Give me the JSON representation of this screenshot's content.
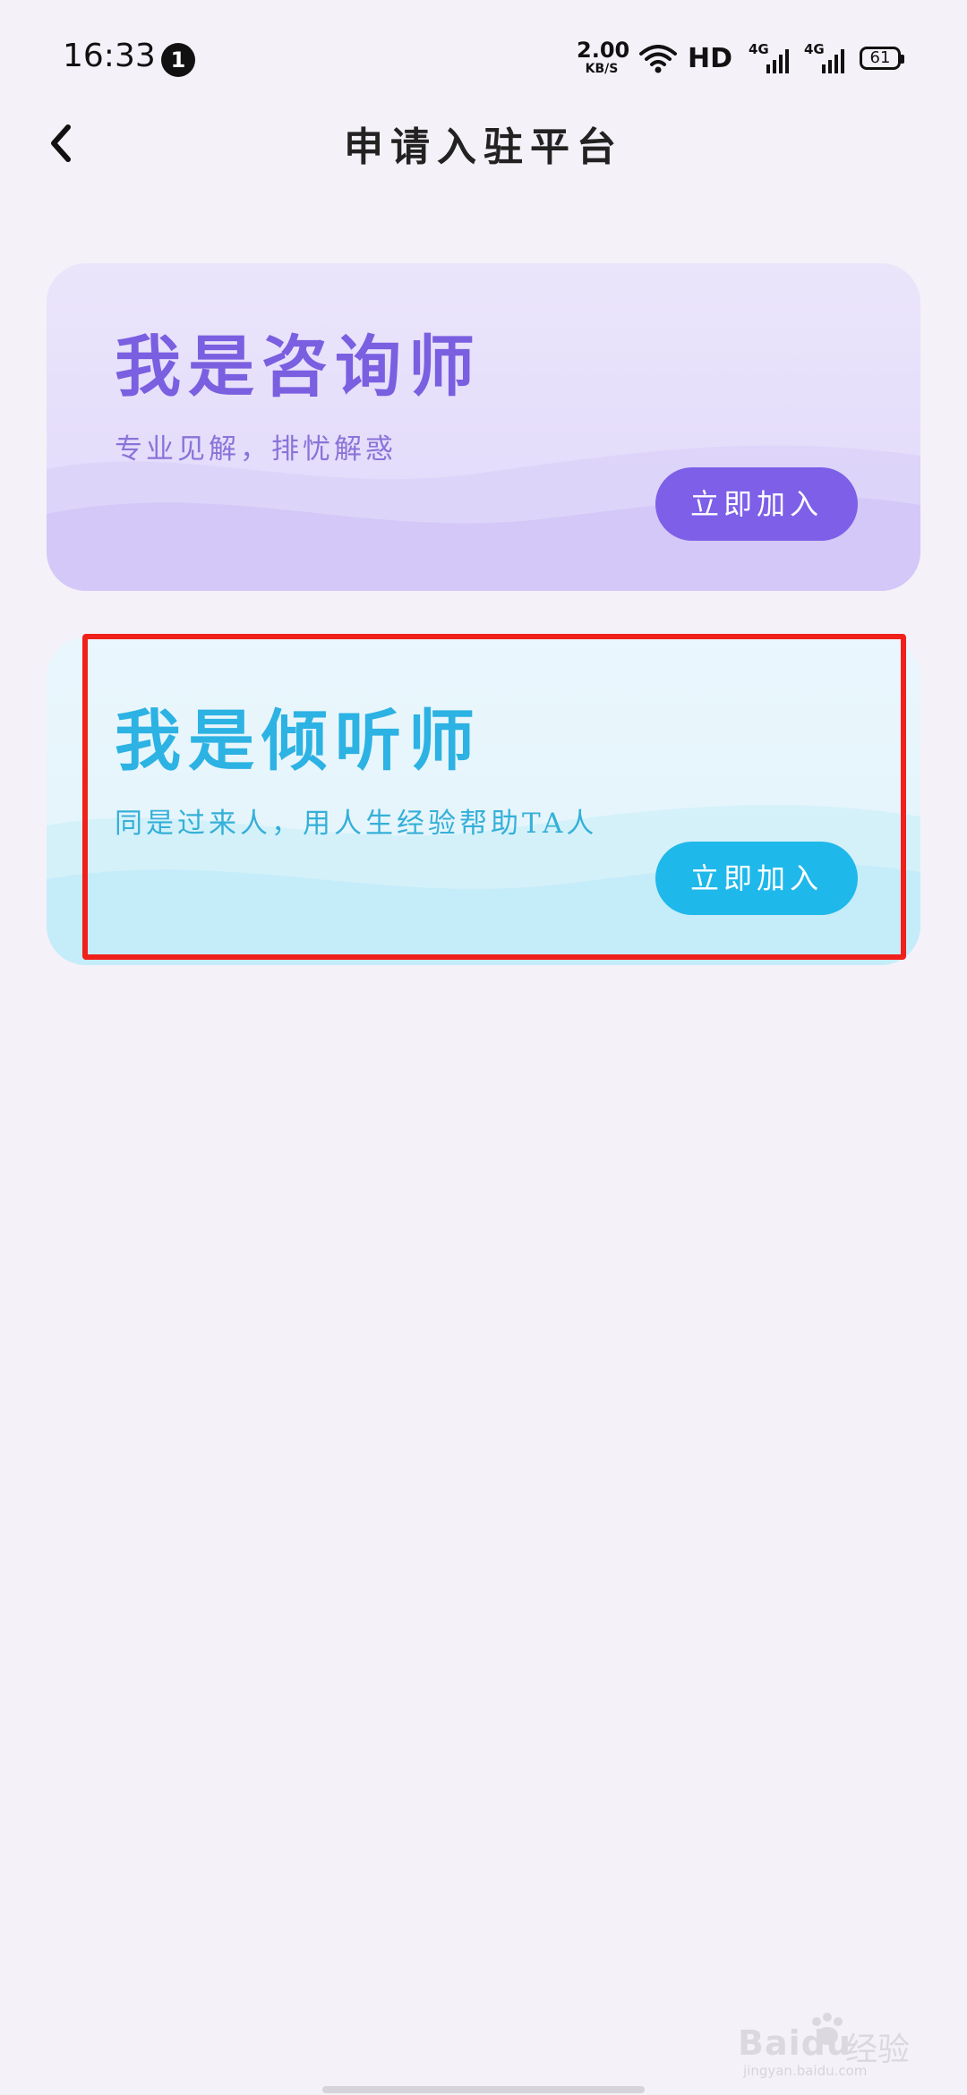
{
  "status_bar": {
    "time": "16:33",
    "notification_count": "1",
    "net_speed_value": "2.00",
    "net_speed_unit": "KB/S",
    "hd_label": "HD",
    "signal1_label": "4G",
    "signal2_label": "4G",
    "battery_level": "61"
  },
  "header": {
    "title": "申请入驻平台",
    "back_icon": "chevron-left-icon"
  },
  "cards": [
    {
      "title": "我是咨询师",
      "subtitle": "专业见解，排忧解惑",
      "button_label": "立即加入",
      "accent_color": "#7d5fe8"
    },
    {
      "title": "我是倾听师",
      "subtitle": "同是过来人，用人生经验帮助TA人",
      "button_label": "立即加入",
      "accent_color": "#1fb8ea"
    }
  ],
  "watermark": {
    "brand": "Baidu",
    "brand_cn": "经验",
    "url": "jingyan.baidu.com"
  },
  "colors": {
    "background": "#f4f1f8",
    "highlight": "#f0201b"
  }
}
